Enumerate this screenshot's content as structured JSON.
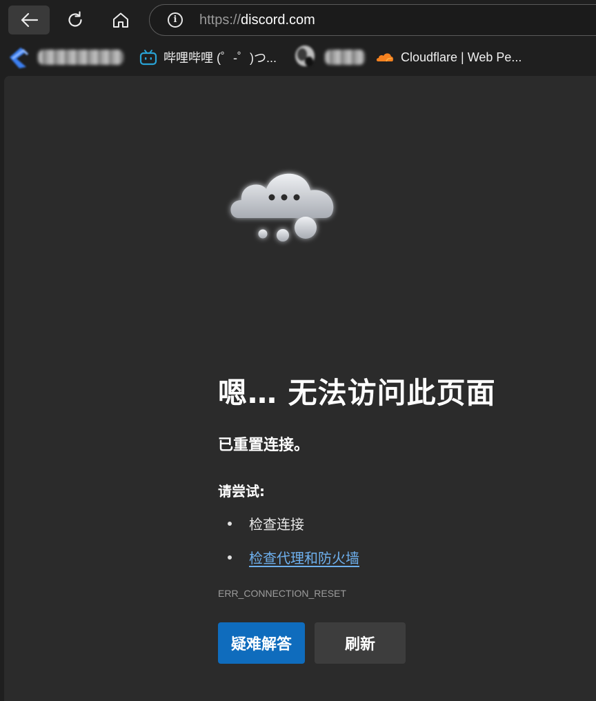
{
  "browser": {
    "url_scheme": "https://",
    "url_host": "discord.com",
    "icons": {
      "back": "arrow-left-icon",
      "reload": "reload-icon",
      "home": "home-icon",
      "site_info": "info-icon"
    }
  },
  "favorites": [
    {
      "label": "",
      "icon": "blurred-favicon",
      "obscured": true
    },
    {
      "label": "哔哩哔哩 (゜-゜)つ...",
      "icon": "bilibili-icon"
    },
    {
      "label": "",
      "icon": "blurred-favicon",
      "obscured": true
    },
    {
      "label": "Cloudflare | Web Pe...",
      "icon": "cloudflare-icon"
    }
  ],
  "error_page": {
    "illustration": "cloud-icon",
    "heading": "嗯… 无法访问此页面",
    "subtitle": "已重置连接。",
    "try_label": "请尝试:",
    "suggestions": [
      {
        "text": "检查连接",
        "is_link": false
      },
      {
        "text": "检查代理和防火墙",
        "is_link": true
      }
    ],
    "error_code": "ERR_CONNECTION_RESET",
    "buttons": {
      "troubleshoot": "疑难解答",
      "refresh": "刷新"
    }
  },
  "colors": {
    "page_background": "#2b2b2b",
    "chrome_background": "#1f1f1f",
    "primary_button": "#0f6cbd",
    "secondary_button": "#3d3d3d",
    "link": "#6eb0ee"
  }
}
